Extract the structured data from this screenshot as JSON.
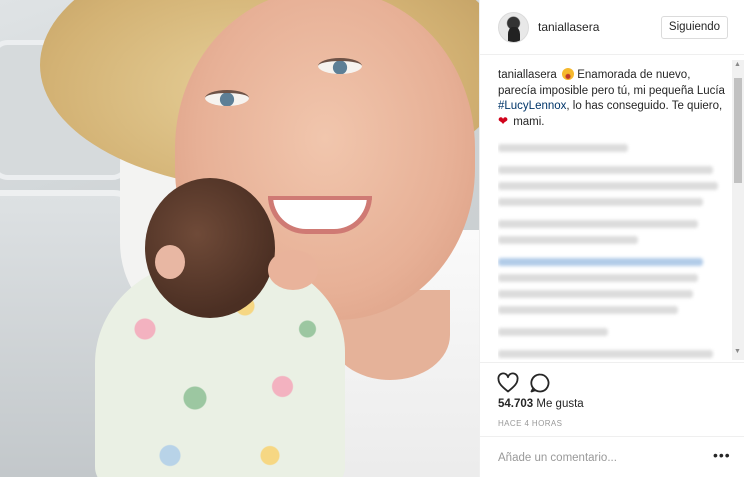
{
  "post": {
    "username": "taniallasera",
    "follow_label": "Siguiendo",
    "caption_user": "taniallasera",
    "caption_part1": " Enamorada de nuevo, parecía imposible pero tú, mi pequeña Lucía ",
    "caption_hashtag": "#LucyLennox",
    "caption_part2": ", lo has conseguido. Te quiero, ",
    "caption_part3": " mami.",
    "likes_count": "54.703",
    "likes_label": " Me gusta",
    "timestamp": "HACE 4 HORAS",
    "comment_placeholder": "Añade un comentario...",
    "more_label": "•••"
  },
  "icons": {
    "like": "heart-outline-icon",
    "comment": "speech-bubble-icon",
    "more": "ellipsis-icon",
    "caption_emoji_1": "heart-eyes-emoji",
    "caption_emoji_2": "red-heart-emoji"
  },
  "colors": {
    "hashtag": "#003569",
    "border": "#efefef",
    "text": "#262626",
    "muted": "#999999"
  }
}
